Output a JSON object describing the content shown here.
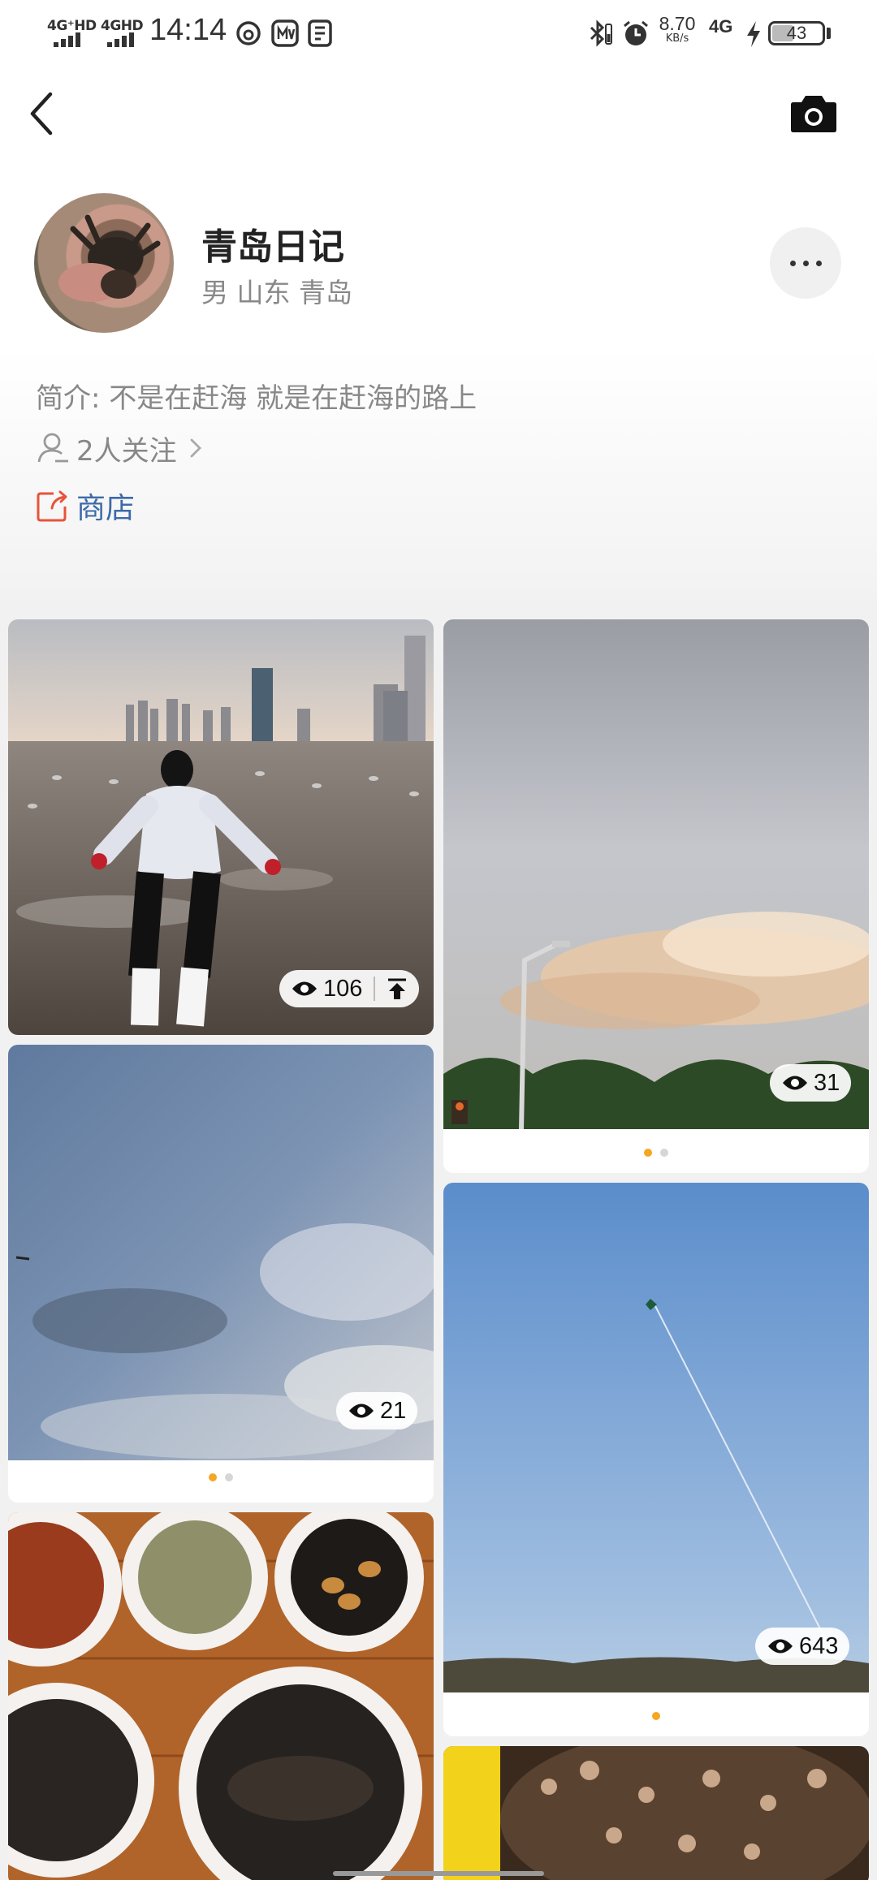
{
  "status_bar": {
    "sim1": "4G⁺HD",
    "sim2": "4GHD",
    "time": "14:14",
    "speed_value": "8.70",
    "speed_unit": "KB/s",
    "network": "4G",
    "battery": "43"
  },
  "profile": {
    "nickname": "青岛日记",
    "meta": "男 山东 青岛",
    "bio": "简介: 不是在赶海  就是在赶海的路上",
    "following": "2人关注",
    "shop": "商店"
  },
  "posts": [
    {
      "views": "106",
      "photo": "beach-tide-flats-girl"
    },
    {
      "views": "31",
      "photo": "sunset-clouds-streetlight"
    },
    {
      "views": "21",
      "photo": "cloudy-sky"
    },
    {
      "views": "643",
      "photo": "blue-sky-kite"
    },
    {
      "views": "",
      "photo": "seafood-bowls"
    },
    {
      "views": "",
      "photo": "seafood-closeup"
    }
  ],
  "colors": {
    "accent_orange": "#f5a623",
    "link_blue": "#3d6aa8",
    "shop_icon_red": "#e8533a"
  }
}
